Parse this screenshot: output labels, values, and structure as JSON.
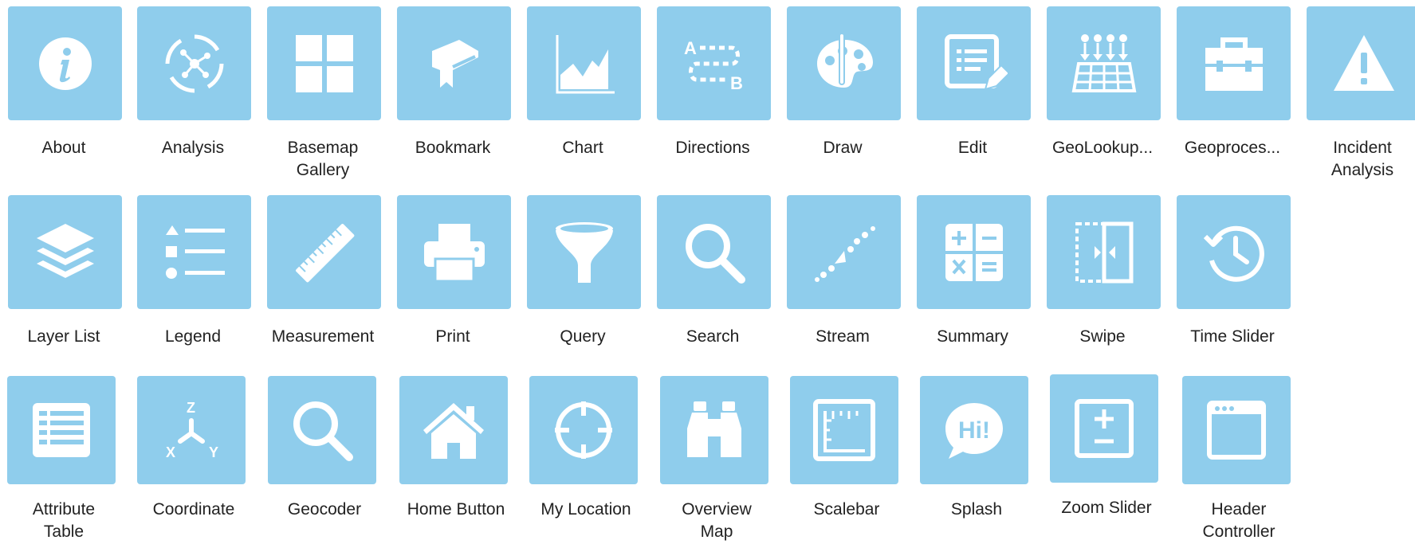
{
  "colors": {
    "tile_bg": "#8fcdec",
    "icon_fg": "#ffffff",
    "label_text": "#222222"
  },
  "widgets": [
    {
      "label": "About",
      "icon": "info-icon"
    },
    {
      "label": "Analysis",
      "icon": "analysis-icon"
    },
    {
      "label": "Basemap\nGallery",
      "icon": "basemap-gallery-icon"
    },
    {
      "label": "Bookmark",
      "icon": "bookmark-book-icon"
    },
    {
      "label": "Chart",
      "icon": "area-chart-icon"
    },
    {
      "label": "Directions",
      "icon": "directions-a-to-b-icon"
    },
    {
      "label": "Draw",
      "icon": "palette-icon"
    },
    {
      "label": "Edit",
      "icon": "edit-form-icon"
    },
    {
      "label": "GeoLookup...",
      "icon": "geolookup-grid-icon"
    },
    {
      "label": "Geoproces...",
      "icon": "toolbox-icon"
    },
    {
      "label": "Incident\nAnalysis",
      "icon": "warning-icon"
    },
    {
      "label": "Layer List",
      "icon": "layers-icon"
    },
    {
      "label": "Legend",
      "icon": "legend-list-icon"
    },
    {
      "label": "Measurement",
      "icon": "ruler-icon"
    },
    {
      "label": "Print",
      "icon": "printer-icon"
    },
    {
      "label": "Query",
      "icon": "funnel-icon"
    },
    {
      "label": "Search",
      "icon": "search-icon"
    },
    {
      "label": "Stream",
      "icon": "stream-icon"
    },
    {
      "label": "Summary",
      "icon": "calculator-icon"
    },
    {
      "label": "Swipe",
      "icon": "swipe-icon"
    },
    {
      "label": "Time Slider",
      "icon": "history-clock-icon"
    },
    {
      "label": "Attribute\nTable",
      "icon": "table-icon"
    },
    {
      "label": "Coordinate",
      "icon": "xyz-axes-icon"
    },
    {
      "label": "Geocoder",
      "icon": "search-icon"
    },
    {
      "label": "Home Button",
      "icon": "home-icon"
    },
    {
      "label": "My Location",
      "icon": "crosshair-icon"
    },
    {
      "label": "Overview\nMap",
      "icon": "binoculars-icon"
    },
    {
      "label": "Scalebar",
      "icon": "scalebar-icon"
    },
    {
      "label": "Splash",
      "icon": "speech-bubble-hi-icon"
    },
    {
      "label": "Zoom Slider",
      "icon": "zoom-slider-icon"
    },
    {
      "label": "Header\nController",
      "icon": "window-icon"
    }
  ]
}
